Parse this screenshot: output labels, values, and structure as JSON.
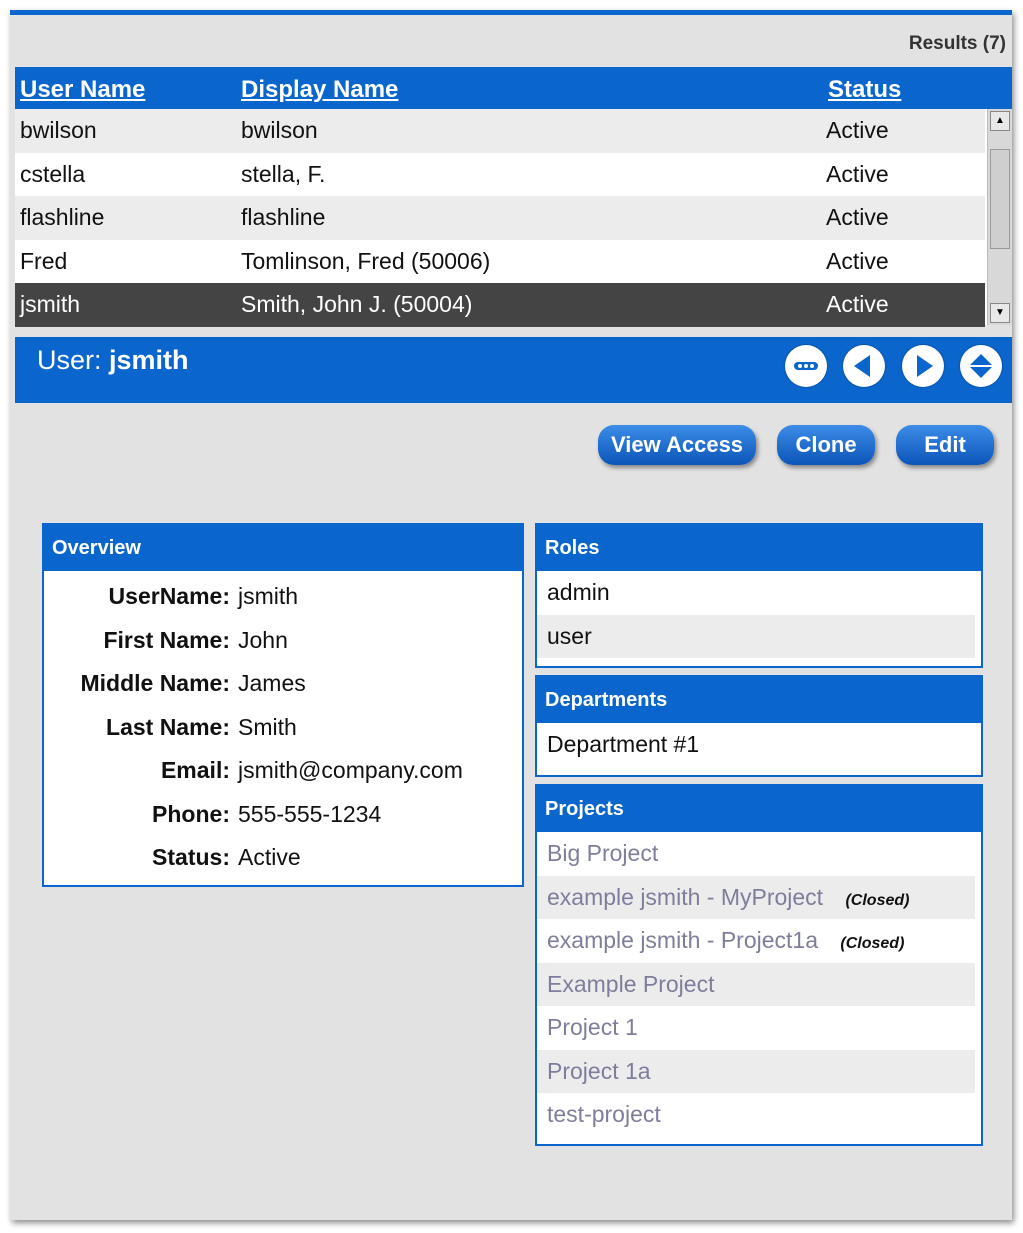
{
  "results": "Results (7)",
  "grid": {
    "headers": {
      "username": "User Name",
      "displayname": "Display Name",
      "status": "Status"
    },
    "rows": [
      {
        "username": "bwilson",
        "displayname": "bwilson",
        "status": "Active"
      },
      {
        "username": "cstella",
        "displayname": "stella, F.",
        "status": "Active"
      },
      {
        "username": "flashline",
        "displayname": "flashline",
        "status": "Active"
      },
      {
        "username": "Fred",
        "displayname": "Tomlinson, Fred (50006)",
        "status": "Active"
      },
      {
        "username": "jsmith",
        "displayname": "Smith, John J. (50004)",
        "status": "Active"
      }
    ]
  },
  "user": {
    "prefix": "User:",
    "name": "jsmith"
  },
  "nav_icons": [
    "collapse-icon",
    "previous-icon",
    "next-icon",
    "expand-icon"
  ],
  "buttons": {
    "view_access": "View Access",
    "clone": "Clone",
    "edit": "Edit"
  },
  "overview": {
    "title": "Overview",
    "fields": [
      {
        "label": "UserName:",
        "value": "jsmith"
      },
      {
        "label": "First Name:",
        "value": "John"
      },
      {
        "label": "Middle Name:",
        "value": "James"
      },
      {
        "label": "Last Name:",
        "value": "Smith"
      },
      {
        "label": "Email:",
        "value": "jsmith@company.com"
      },
      {
        "label": "Phone:",
        "value": "555-555-1234"
      },
      {
        "label": "Status:",
        "value": "Active"
      }
    ]
  },
  "roles": {
    "title": "Roles",
    "items": [
      "admin",
      "user"
    ]
  },
  "departments": {
    "title": "Departments",
    "items": [
      "Department #1"
    ]
  },
  "projects": {
    "title": "Projects",
    "items": [
      {
        "name": "Big Project",
        "tag": ""
      },
      {
        "name": "example jsmith - MyProject",
        "tag": "(Closed)"
      },
      {
        "name": "example jsmith - Project1a",
        "tag": "(Closed)"
      },
      {
        "name": "Example Project",
        "tag": ""
      },
      {
        "name": "Project 1",
        "tag": ""
      },
      {
        "name": "Project 1a",
        "tag": ""
      },
      {
        "name": "test-project",
        "tag": ""
      }
    ]
  },
  "colors": {
    "accent": "#0a66cc",
    "selected_row": "#444444",
    "project_link": "#7e7e9c"
  }
}
